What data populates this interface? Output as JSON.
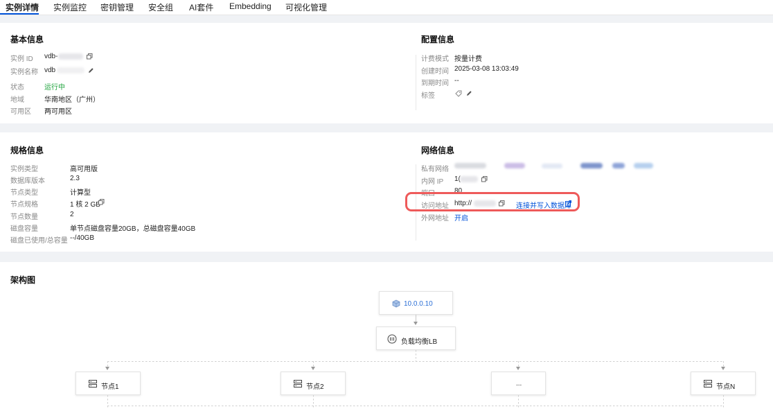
{
  "tabs": [
    {
      "label": "实例详情"
    },
    {
      "label": "实例监控"
    },
    {
      "label": "密钥管理"
    },
    {
      "label": "安全组"
    },
    {
      "label": "AI套件"
    },
    {
      "label": "Embedding"
    },
    {
      "label": "可视化管理"
    }
  ],
  "basic": {
    "title": "基本信息",
    "id_label": "实例 ID",
    "id_value": "vdb-",
    "name_label": "实例名称",
    "name_value": "vdb",
    "status_label": "状态",
    "status_value": "运行中",
    "region_label": "地域",
    "region_value": "华南地区（广州）",
    "zone_label": "可用区",
    "zone_value": "两可用区"
  },
  "config": {
    "title": "配置信息",
    "billing_label": "计费模式",
    "billing_value": "按量计费",
    "created_label": "创建时间",
    "created_value": "2025-03-08 13:03:49",
    "expire_label": "到期时间",
    "expire_value": "--",
    "tag_label": "标签"
  },
  "spec": {
    "title": "规格信息",
    "type_label": "实例类型",
    "type_value": "高可用版",
    "version_label": "数据库版本",
    "version_value": "2.3",
    "node_type_label": "节点类型",
    "node_type_value": "计算型",
    "node_spec_label": "节点规格",
    "node_spec_value": "1 核 2 GB",
    "node_count_label": "节点数量",
    "node_count_value": "2",
    "disk_label": "磁盘容量",
    "disk_value": "单节点磁盘容量20GB，总磁盘容量40GB",
    "disk_used_label": "磁盘已使用/总容量",
    "disk_used_value": "--/40GB"
  },
  "network": {
    "title": "网络信息",
    "vpc_label": "私有网络",
    "ip_label": "内网 IP",
    "ip_value": "1(",
    "port_label": "端口",
    "port_value": "80",
    "access_label": "访问地址",
    "access_value": "http://",
    "connect_link": "连接并写入数据库",
    "public_label": "外网地址",
    "public_value": "开启"
  },
  "arch": {
    "title": "架构图",
    "vip": "10.0.0.10",
    "lb": "负载均衡LB",
    "nodes": [
      "节点1",
      "节点2",
      "...",
      "节点N"
    ]
  },
  "colors": {
    "accent": "#0052d9",
    "running": "#1ea33c",
    "highlight": "#ee5a5a"
  }
}
